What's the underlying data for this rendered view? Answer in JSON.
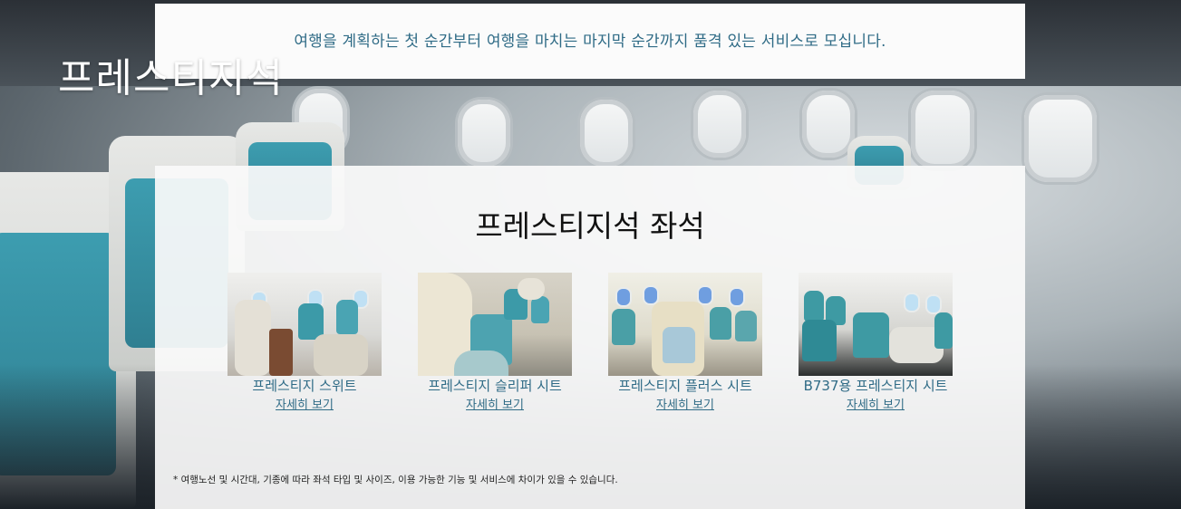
{
  "banner": {
    "tagline": "여행을 계획하는 첫 순간부터 여행을 마치는 마지막 순간까지 품격 있는 서비스로 모십니다."
  },
  "page": {
    "title": "프레스티지석"
  },
  "seats_section": {
    "title": "프레스티지석 좌석",
    "cards": [
      {
        "name": "프레스티지 스위트",
        "link": "자세히 보기",
        "photo": "prestige-suite-photo"
      },
      {
        "name": "프레스티지 슬리퍼 시트",
        "link": "자세히 보기",
        "photo": "prestige-sleeper-photo"
      },
      {
        "name": "프레스티지 플러스 시트",
        "link": "자세히 보기",
        "photo": "prestige-plus-photo"
      },
      {
        "name": "B737용 프레스티지 시트",
        "link": "자세히 보기",
        "photo": "b737-prestige-photo"
      }
    ],
    "footnote": "* 여행노선 및 시간대, 기종에 따라 좌석 타입 및 사이즈, 이용 가능한 기능 및 서비스에 차이가 있을 수 있습니다."
  },
  "colors": {
    "accent": "#2f6b86",
    "seat_teal": "#3c9aa8",
    "panel": "#fafafa"
  }
}
